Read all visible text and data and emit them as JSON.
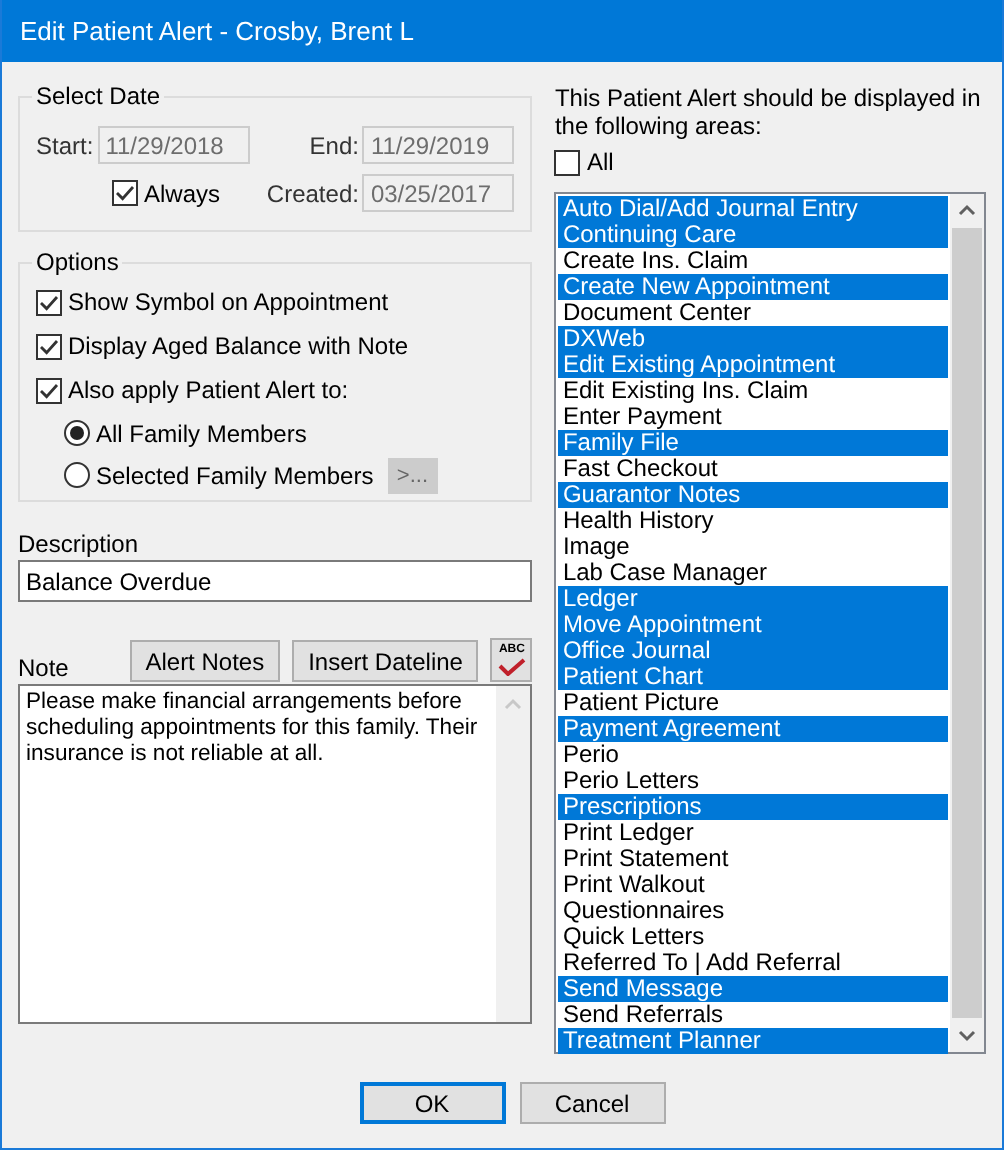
{
  "window": {
    "title": "Edit Patient Alert - Crosby, Brent L"
  },
  "select_date": {
    "legend": "Select Date",
    "start": {
      "label": "Start:",
      "value": "11/29/2018",
      "disabled": true
    },
    "end": {
      "label": "End:",
      "value": "11/29/2019",
      "disabled": true
    },
    "always": {
      "label": "Always",
      "checked": true
    },
    "created": {
      "label": "Created:",
      "value": "03/25/2017",
      "disabled": true
    }
  },
  "options": {
    "legend": "Options",
    "checkboxes": [
      {
        "label": "Show Symbol on Appointment",
        "checked": true
      },
      {
        "label": "Display Aged Balance with Note",
        "checked": true
      },
      {
        "label": "Also apply Patient Alert to:",
        "checked": true
      }
    ],
    "radios": [
      {
        "label": "All Family Members",
        "selected": true
      },
      {
        "label": "Selected Family Members",
        "selected": false
      }
    ],
    "members_button": {
      "label": ">...",
      "disabled": true
    }
  },
  "description": {
    "label": "Description",
    "value": "Balance Overdue"
  },
  "note": {
    "label": "Note",
    "buttons": [
      "Alert Notes",
      "Insert Dateline"
    ],
    "spell_button": "ABC",
    "value": "Please make financial arrangements before scheduling appointments for this family. Their insurance is not reliable at all."
  },
  "areas": {
    "prompt": "This Patient Alert should be displayed in the following areas:",
    "all": {
      "label": "All",
      "checked": false
    },
    "items": [
      {
        "label": "Auto Dial/Add Journal Entry",
        "selected": true
      },
      {
        "label": "Continuing Care",
        "selected": true
      },
      {
        "label": "Create Ins. Claim",
        "selected": false
      },
      {
        "label": "Create New Appointment",
        "selected": true
      },
      {
        "label": "Document Center",
        "selected": false
      },
      {
        "label": "DXWeb",
        "selected": true
      },
      {
        "label": "Edit Existing Appointment",
        "selected": true
      },
      {
        "label": "Edit Existing Ins. Claim",
        "selected": false
      },
      {
        "label": "Enter Payment",
        "selected": false
      },
      {
        "label": "Family File",
        "selected": true
      },
      {
        "label": "Fast Checkout",
        "selected": false
      },
      {
        "label": "Guarantor Notes",
        "selected": true
      },
      {
        "label": "Health History",
        "selected": false
      },
      {
        "label": "Image",
        "selected": false
      },
      {
        "label": "Lab Case Manager",
        "selected": false
      },
      {
        "label": "Ledger",
        "selected": true
      },
      {
        "label": "Move Appointment",
        "selected": true
      },
      {
        "label": "Office Journal",
        "selected": true
      },
      {
        "label": "Patient Chart",
        "selected": true
      },
      {
        "label": "Patient Picture",
        "selected": false
      },
      {
        "label": "Payment Agreement",
        "selected": true
      },
      {
        "label": "Perio",
        "selected": false
      },
      {
        "label": "Perio Letters",
        "selected": false
      },
      {
        "label": "Prescriptions",
        "selected": true
      },
      {
        "label": "Print Ledger",
        "selected": false
      },
      {
        "label": "Print Statement",
        "selected": false
      },
      {
        "label": "Print Walkout",
        "selected": false
      },
      {
        "label": "Questionnaires",
        "selected": false
      },
      {
        "label": "Quick Letters",
        "selected": false
      },
      {
        "label": "Referred To | Add Referral",
        "selected": false
      },
      {
        "label": "Send Message",
        "selected": true
      },
      {
        "label": "Send Referrals",
        "selected": false
      },
      {
        "label": "Treatment Planner",
        "selected": true
      }
    ]
  },
  "buttons": [
    {
      "label": "OK",
      "default": true
    },
    {
      "label": "Cancel",
      "default": false
    }
  ]
}
